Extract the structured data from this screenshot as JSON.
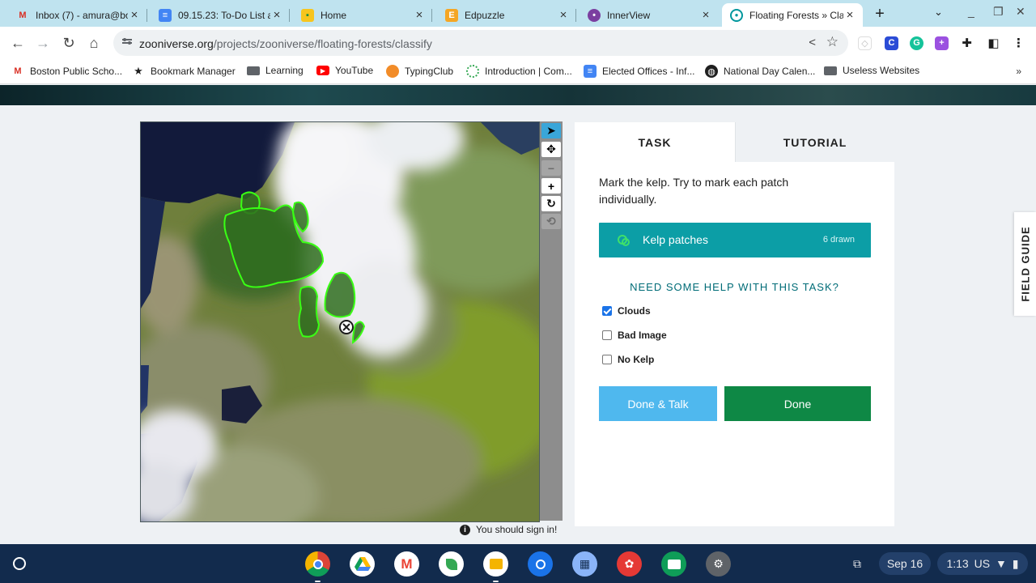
{
  "colors": {
    "accent_teal": "#0c9ea6",
    "done_green": "#0e8845",
    "talk_blue": "#4fb8ee",
    "kelp_outline": "#39ff14",
    "shelf": "#122b4d"
  },
  "browser": {
    "tabs": [
      {
        "title": "Inbox (7) - amura@bo",
        "icon": "gmail-icon"
      },
      {
        "title": "09.15.23: To-Do List a",
        "icon": "docs-icon"
      },
      {
        "title": "Home",
        "icon": "classroom-icon"
      },
      {
        "title": "Edpuzzle",
        "icon": "edpuzzle-icon"
      },
      {
        "title": "InnerView",
        "icon": "innerview-icon"
      },
      {
        "title": "Floating Forests » Cla",
        "icon": "zooniverse-icon"
      }
    ],
    "url_host": "zooniverse.org",
    "url_path": "/projects/zooniverse/floating-forests/classify",
    "bookmarks": [
      {
        "label": "Boston Public Scho...",
        "icon": "gmail-icon"
      },
      {
        "label": "Bookmark Manager",
        "icon": "star-icon"
      },
      {
        "label": "Learning",
        "icon": "folder-icon"
      },
      {
        "label": "YouTube",
        "icon": "youtube-icon"
      },
      {
        "label": "TypingClub",
        "icon": "typingclub-icon"
      },
      {
        "label": "Introduction | Com...",
        "icon": "course-icon"
      },
      {
        "label": "Elected Offices - Inf...",
        "icon": "docs-icon"
      },
      {
        "label": "National Day Calen...",
        "icon": "globe-icon"
      },
      {
        "label": "Useless Websites",
        "icon": "folder-icon"
      }
    ],
    "bookmarks_more": "»"
  },
  "classifier": {
    "tools": [
      "pointer-icon",
      "move-icon",
      "zoom-out-icon",
      "zoom-in-icon",
      "rotate-icon",
      "reset-icon"
    ],
    "signin_notice": "You should sign in!",
    "tabs": {
      "task": "TASK",
      "tutorial": "TUTORIAL"
    },
    "instructions": "Mark the kelp. Try to mark each patch individually.",
    "kelp_tool": {
      "label": "Kelp patches",
      "count": "6 drawn"
    },
    "help_title": "NEED SOME HELP WITH THIS TASK?",
    "options": [
      {
        "label": "Clouds",
        "checked": true
      },
      {
        "label": "Bad Image",
        "checked": false
      },
      {
        "label": "No Kelp",
        "checked": false
      }
    ],
    "done_talk": "Done & Talk",
    "done": "Done",
    "field_guide": "FIELD GUIDE"
  },
  "shelf": {
    "apps": [
      "chrome-icon",
      "drive-icon",
      "gmail-icon",
      "classroom-icon",
      "slides-icon",
      "camera-icon",
      "print-icon",
      "paint-icon",
      "forms-icon",
      "settings-icon"
    ],
    "date": "Sep 16",
    "time": "1:13",
    "ime": "US"
  }
}
